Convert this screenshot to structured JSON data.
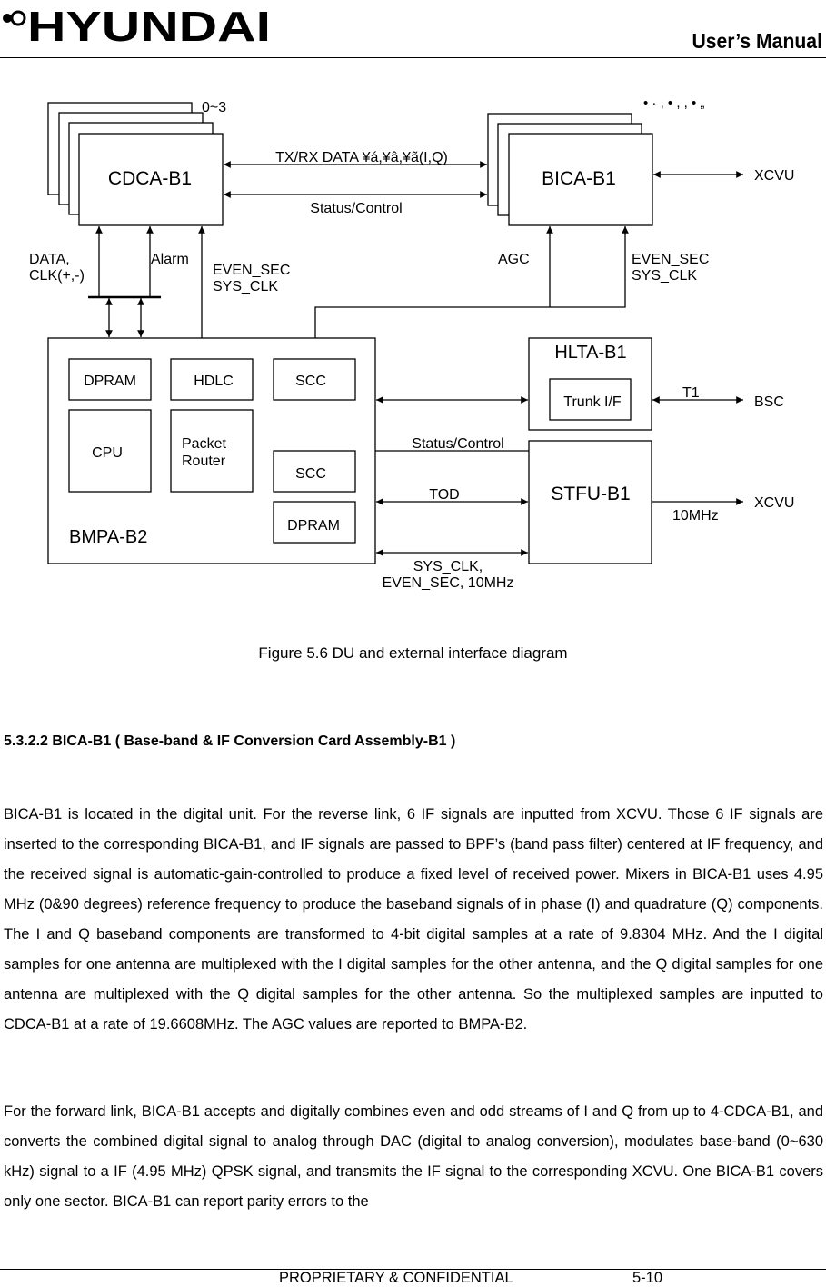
{
  "header": {
    "logo_text": "HYUNDAI",
    "manual_title": "User’s Manual"
  },
  "diagram": {
    "cdca": {
      "label": "CDCA-B1",
      "count_label": "0~3"
    },
    "bica": {
      "label": "BICA-B1",
      "garbled_label": "• ·  , •  ,   , •  „"
    },
    "links": {
      "txrx": "TX/RX DATA ¥á,¥â,¥ã(I,Q)",
      "status_top": "Status/Control",
      "xcvu_top": "XCVU",
      "data_clk_1": "DATA,",
      "data_clk_2": "CLK(+,-)",
      "alarm": "Alarm",
      "even_sec_left_1": "EVEN_SEC",
      "even_sec_left_2": "SYS_CLK",
      "agc": "AGC",
      "even_sec_right_1": "EVEN_SEC",
      "even_sec_right_2": "SYS_CLK",
      "t1": "T1",
      "bsc": "BSC",
      "status_mid": "Status/Control",
      "tod": "TOD",
      "xcvu_bottom": "XCVU",
      "tenmhz": "10MHz",
      "sysclk_1": "SYS_CLK,",
      "sysclk_2": "EVEN_SEC, 10MHz"
    },
    "bmpa": {
      "label": "BMPA-B2",
      "blocks": {
        "dpram_top": "DPRAM",
        "hdlc": "HDLC",
        "scc_top": "SCC",
        "cpu": "CPU",
        "packet_1": "Packet",
        "packet_2": "Router",
        "scc_bottom": "SCC",
        "dpram_bottom": "DPRAM"
      }
    },
    "hlta": {
      "label": "HLTA-B1",
      "trunk": "Trunk I/F"
    },
    "stfu": {
      "label": "STFU-B1"
    }
  },
  "figure_caption": "Figure 5.6 DU and external interface diagram",
  "section": {
    "heading": "5.3.2.2  BICA-B1 ( Base-band & IF Conversion Card Assembly-B1 )",
    "paragraphs": [
      "BICA-B1 is located in the digital unit. For the reverse link, 6 IF signals are inputted from XCVU. Those 6 IF signals are inserted to the corresponding BICA-B1, and IF signals are passed to BPF’s (band pass filter) centered at IF frequency, and the received signal is automatic-gain-controlled to produce a fixed level of received power. Mixers in BICA-B1 uses 4.95 MHz (0&90 degrees) reference frequency to produce the baseband signals of in phase (I) and quadrature (Q) components. The I and Q baseband components are transformed to 4-bit digital samples at a rate of 9.8304 MHz. And the I digital samples for one antenna are multiplexed with the I digital samples for the other antenna, and the Q digital samples for one antenna are multiplexed with the Q digital samples for the other antenna. So the multiplexed samples are inputted to CDCA-B1 at a rate of 19.6608MHz. The AGC values are reported to BMPA-B2.",
      "For the forward link, BICA-B1 accepts and digitally combines even and odd streams of I and Q from up to 4-CDCA-B1, and converts the combined digital signal to analog through DAC (digital to analog conversion), modulates base-band (0~630 kHz) signal to a IF (4.95 MHz) QPSK signal, and transmits the IF signal to the corresponding XCVU. One BICA-B1 covers only one sector. BICA-B1 can report parity errors to the"
    ]
  },
  "footer": {
    "confidential": "PROPRIETARY & CONFIDENTIAL",
    "page_number": "5-10"
  }
}
